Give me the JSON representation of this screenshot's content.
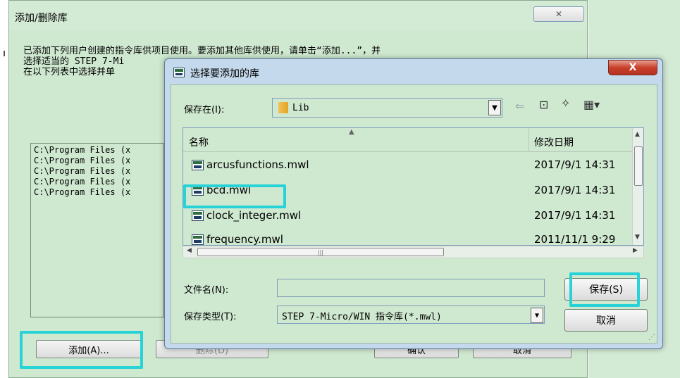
{
  "background_dialog": {
    "title": "添加/删除库",
    "close_label": "✕",
    "description": "已添加下列用户创建的指令库供项目使用。要添加其他库供使用，请单击“添加...”，并\n选择适当的 STEP 7-Mi\n在以下列表中选择并单",
    "library_paths": [
      "C:\\Program Files (x",
      "C:\\Program Files (x",
      "C:\\Program Files (x",
      "C:\\Program Files (x",
      "C:\\Program Files (x"
    ],
    "add_button": "添加(A)...",
    "delete_button": "删除(D)",
    "ok_button": "确认",
    "cancel_button": "取消"
  },
  "save_dialog": {
    "title": "选择要添加的库",
    "close_label": "X",
    "look_in_label": "保存在(I):",
    "look_in_value": "Lib",
    "columns": {
      "name": "名称",
      "date": "修改日期"
    },
    "files": [
      {
        "name": "arcusfunctions.mwl",
        "date": "2017/9/1 14:31"
      },
      {
        "name": "bcd.mwl",
        "date": "2017/9/1 14:31"
      },
      {
        "name": "clock_integer.mwl",
        "date": "2017/9/1 14:31"
      },
      {
        "name": "frequency.mwl",
        "date": "2011/11/1 9:29"
      }
    ],
    "filename_label": "文件名(N):",
    "filename_value": "",
    "filetype_label": "保存类型(T):",
    "filetype_value": "STEP 7-Micro/WIN 指令库(*.mwl)",
    "save_button": "保存(S)",
    "cancel_button": "取消"
  },
  "colors": {
    "highlight": "#27d3d6",
    "panel_green": "#cfe8d0",
    "title_blue": "#c4d9ec",
    "close_red": "#c8402b"
  }
}
